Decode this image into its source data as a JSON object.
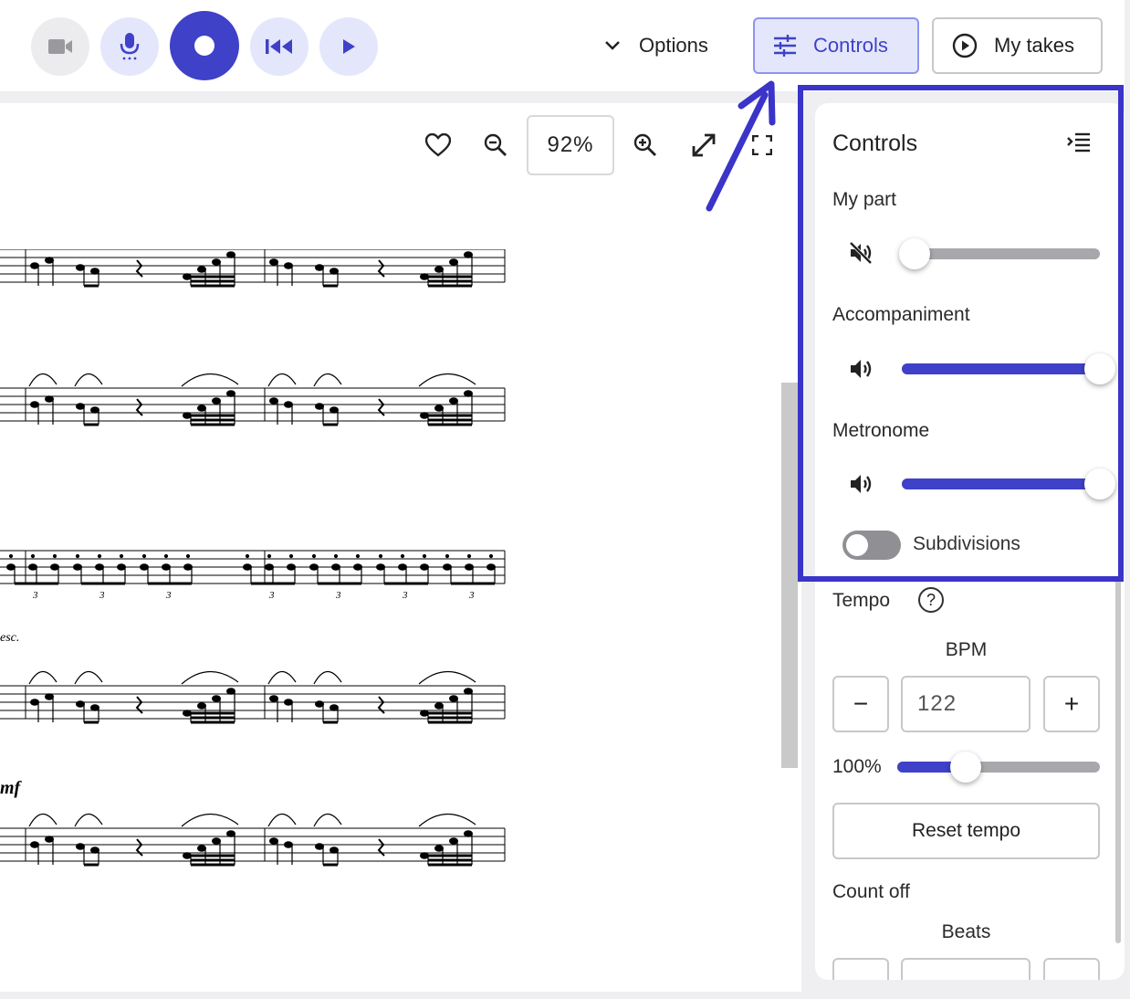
{
  "toolbar": {
    "options_label": "Options",
    "controls_label": "Controls",
    "takes_label": "My takes"
  },
  "sheet": {
    "zoom_level": "92%"
  },
  "panel": {
    "title": "Controls",
    "my_part": {
      "label": "My part",
      "level": 0
    },
    "accompaniment": {
      "label": "Accompaniment",
      "level": 1.0
    },
    "metronome": {
      "label": "Metronome",
      "level": 1.0
    },
    "subdivisions": {
      "label": "Subdivisions",
      "on": false
    },
    "tempo": {
      "label": "Tempo",
      "help": "?",
      "bpm_label": "BPM",
      "bpm_value": "122",
      "minus": "−",
      "plus": "+",
      "percent_label": "100%",
      "percent_level": 0.34,
      "reset_label": "Reset tempo"
    },
    "count_off": {
      "label": "Count off",
      "beats_label": "Beats"
    }
  },
  "colors": {
    "accent": "#3f41c8",
    "accent_light": "#e4e7fb",
    "highlight": "#3a34c8"
  },
  "icons": [
    "video-camera-icon",
    "microphone-icon",
    "record-icon",
    "rewind-icon",
    "play-icon",
    "chevron-down-icon",
    "sliders-icon",
    "play-circle-icon",
    "heart-icon",
    "zoom-out-icon",
    "zoom-in-icon",
    "expand-icon",
    "fullscreen-icon",
    "collapse-panel-icon",
    "muted-speaker-icon",
    "speaker-icon",
    "help-icon"
  ],
  "music_markings": [
    "esc.",
    "mf",
    "3"
  ]
}
